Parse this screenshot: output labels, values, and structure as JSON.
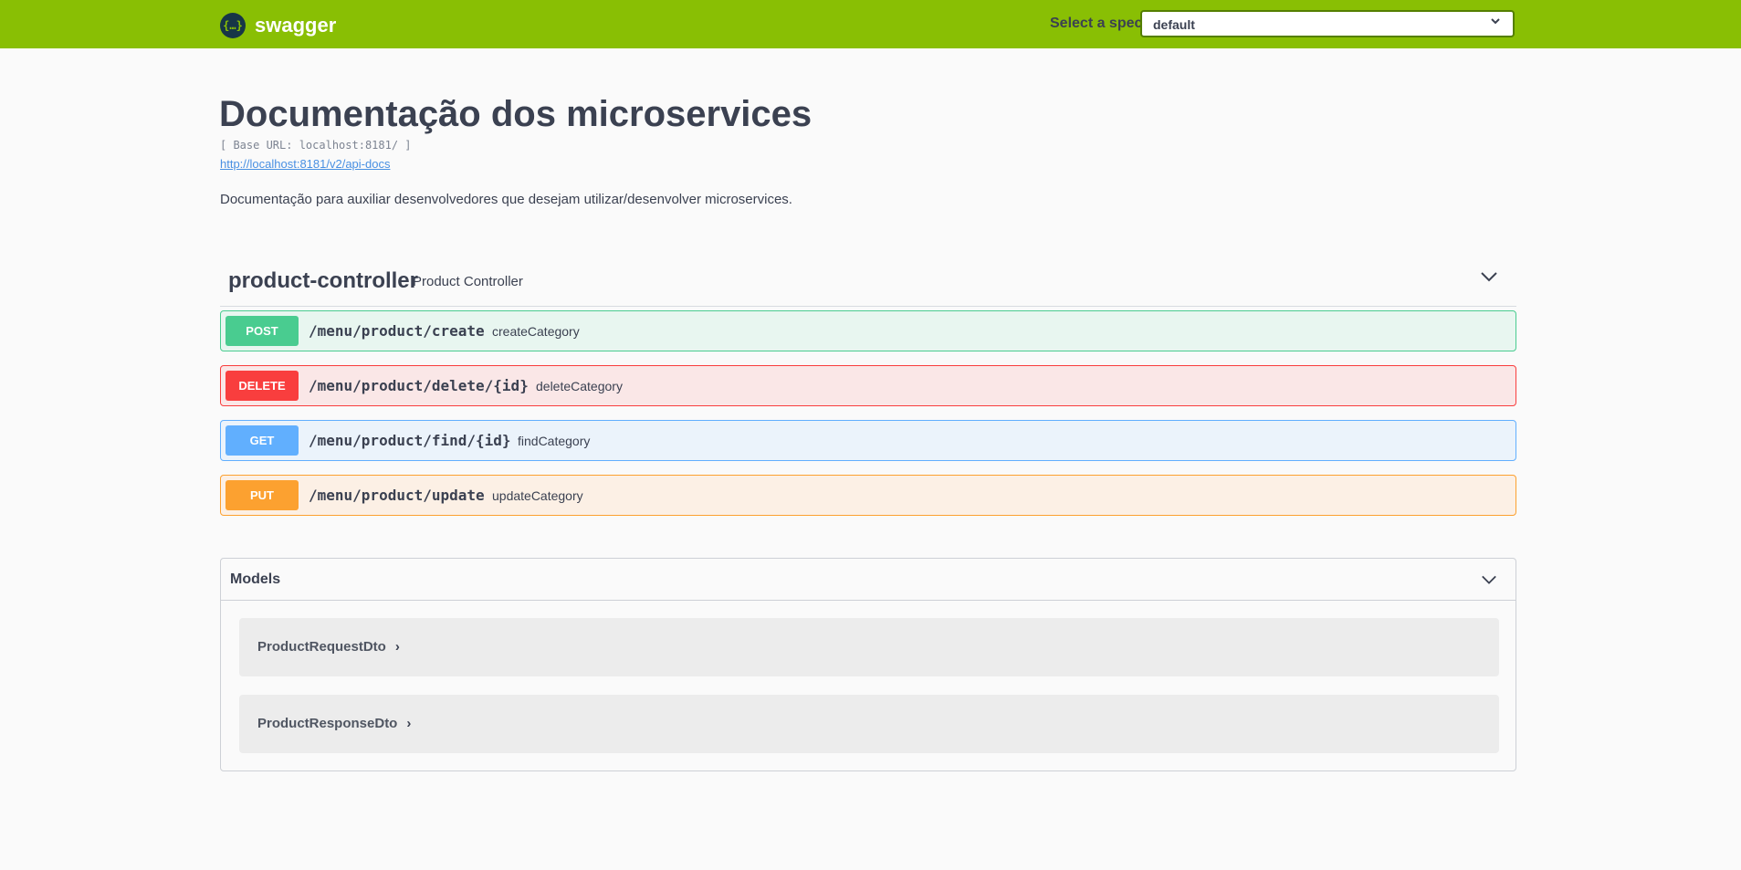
{
  "topbar": {
    "logo_mark": "{…}",
    "logo_text": "swagger",
    "spec_label": "Select a spec",
    "spec_value": "default",
    "bg_color": "#89bf04"
  },
  "info": {
    "title": "Documentação dos microservices",
    "base_url": "[ Base URL: localhost:8181/ ]",
    "docs_link": "http://localhost:8181/v2/api-docs",
    "description": "Documentação para auxiliar desenvolvedores que desejam utilizar/desenvolver microservices."
  },
  "tag": {
    "name": "product-controller",
    "description": "Product Controller"
  },
  "operations": [
    {
      "method": "POST",
      "path": "/menu/product/create",
      "summary": "createCategory",
      "color": "#49cc90"
    },
    {
      "method": "DELETE",
      "path": "/menu/product/delete/{id}",
      "summary": "deleteCategory",
      "color": "#f93e3e"
    },
    {
      "method": "GET",
      "path": "/menu/product/find/{id}",
      "summary": "findCategory",
      "color": "#61affe"
    },
    {
      "method": "PUT",
      "path": "/menu/product/update",
      "summary": "updateCategory",
      "color": "#fca130"
    }
  ],
  "models": {
    "title": "Models",
    "items": [
      {
        "name": "ProductRequestDto"
      },
      {
        "name": "ProductResponseDto"
      }
    ]
  },
  "icons": {
    "chevron_right": "›",
    "chevron_down": "chevron-down-icon"
  }
}
